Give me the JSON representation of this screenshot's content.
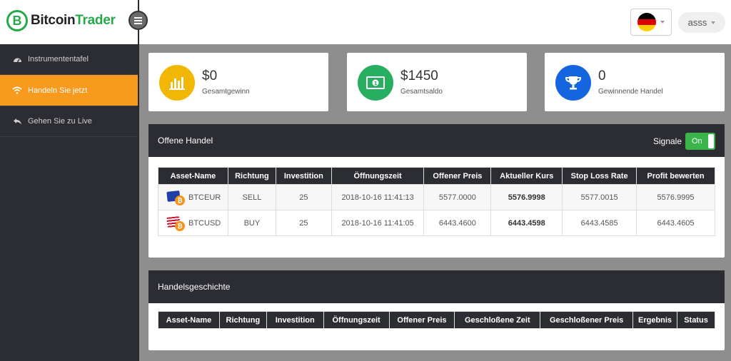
{
  "brand": {
    "part1": "Bitcoin",
    "part2": "Trader",
    "glyph": "B",
    "color": "#27a84a"
  },
  "header": {
    "user_name": "asss",
    "language_icon": "germany-flag-icon",
    "flag_colors": [
      "#000000",
      "#dd0000",
      "#ffce00"
    ]
  },
  "sidebar": {
    "items": [
      {
        "label": "Instrumententafel",
        "icon": "dashboard-icon",
        "active": false
      },
      {
        "label": "Handeln Sie jetzt",
        "icon": "wifi-icon",
        "active": true
      },
      {
        "label": "Gehen Sie zu Live",
        "icon": "reply-icon",
        "active": false
      }
    ],
    "accent": "#f79a1e"
  },
  "stats": [
    {
      "value": "$0",
      "label": "Gesamtgewinn",
      "icon": "bar-chart-icon",
      "color": "#f2b705"
    },
    {
      "value": "$1450",
      "label": "Gesamtsaldo",
      "icon": "money-icon",
      "color": "#27ae60"
    },
    {
      "value": "0",
      "label": "Gewinnende Handel",
      "icon": "trophy-icon",
      "color": "#1565e0"
    }
  ],
  "open_trades": {
    "title": "Offene Handel",
    "signal_label": "Signale",
    "toggle_label": "On",
    "columns": [
      "Asset-Name",
      "Richtung",
      "Investition",
      "Öffnungszeit",
      "Offener Preis",
      "Aktueller Kurs",
      "Stop Loss Rate",
      "Profit bewerten"
    ],
    "rows": [
      {
        "asset": "BTCEUR",
        "direction": "SELL",
        "investment": "25",
        "open_time": "2018-10-16 11:41:13",
        "open_price": "5577.0000",
        "current_rate": "5576.9998",
        "stop_loss": "5577.0015",
        "profit": "5576.9995"
      },
      {
        "asset": "BTCUSD",
        "direction": "BUY",
        "investment": "25",
        "open_time": "2018-10-16 11:41:05",
        "open_price": "6443.4600",
        "current_rate": "6443.4598",
        "stop_loss": "6443.4585",
        "profit": "6443.4605"
      }
    ]
  },
  "history": {
    "title": "Handelsgeschichte",
    "columns": [
      "Asset-Name",
      "Richtung",
      "Investition",
      "Öffnungszeit",
      "Offener Preis",
      "Geschloßene Zeit",
      "Geschloßener Preis",
      "Ergebnis",
      "Status"
    ]
  }
}
